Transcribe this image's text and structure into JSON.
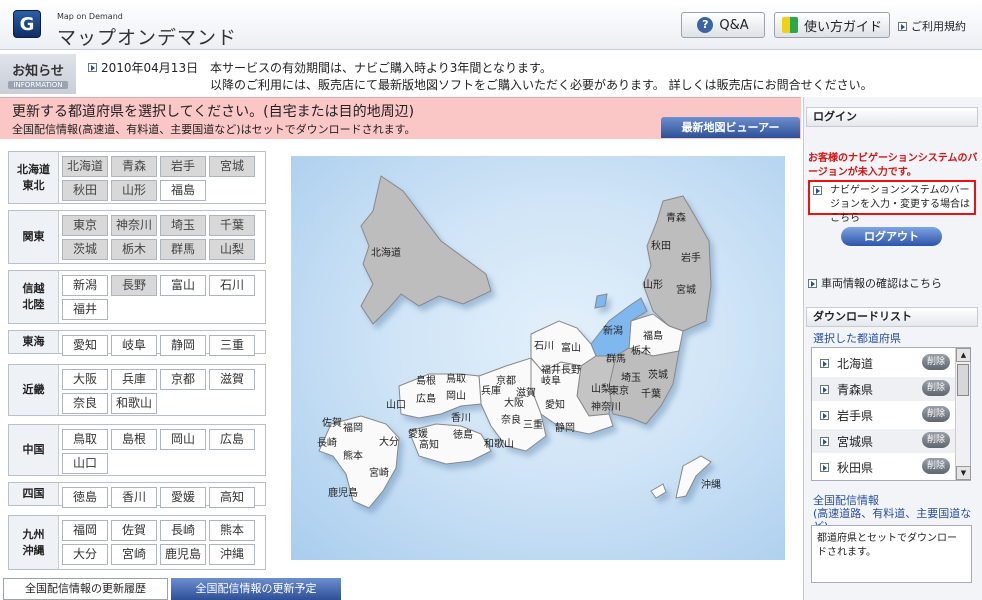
{
  "header": {
    "logo_letter": "G",
    "logo_sub": "Map on Demand",
    "title": "マップオンデマンド",
    "qa_label": "Q&A",
    "qa_icon": "?",
    "guide_label": "使い方ガイド",
    "terms_label": "ご利用規約"
  },
  "info": {
    "tag": "お知らせ",
    "tag_sub": "INFORMATION",
    "date": "2010年04月13日",
    "line1": "本サービスの有効期間は、ナビご購入時より3年間となります。",
    "line2": "以降のご利用には、販売店にて最新版地図ソフトをご購入いただく必要があります。 詳しくは販売店にお問合せください。"
  },
  "select": {
    "title": "更新する都道府県を選択してください。(自宅または目的地周辺)",
    "subtitle": "全国配信情報(高速道、有料道、主要国道など)はセットでダウンロードされます。",
    "viewer_button": "最新地図ビューアー"
  },
  "regions": [
    {
      "label": [
        "北海道",
        "東北"
      ],
      "prefs": [
        {
          "name": "北海道",
          "selected": true
        },
        {
          "name": "青森",
          "selected": true
        },
        {
          "name": "岩手",
          "selected": true
        },
        {
          "name": "宮城",
          "selected": true
        },
        {
          "name": "秋田",
          "selected": true
        },
        {
          "name": "山形",
          "selected": true
        },
        {
          "name": "福島",
          "selected": false
        }
      ]
    },
    {
      "label": [
        "関東"
      ],
      "prefs": [
        {
          "name": "東京",
          "selected": true
        },
        {
          "name": "神奈川",
          "selected": true
        },
        {
          "name": "埼玉",
          "selected": true
        },
        {
          "name": "千葉",
          "selected": true
        },
        {
          "name": "茨城",
          "selected": true
        },
        {
          "name": "栃木",
          "selected": true
        },
        {
          "name": "群馬",
          "selected": true
        },
        {
          "name": "山梨",
          "selected": true
        }
      ]
    },
    {
      "label": [
        "信越",
        "北陸"
      ],
      "prefs": [
        {
          "name": "新潟",
          "selected": false
        },
        {
          "name": "長野",
          "selected": true
        },
        {
          "name": "富山",
          "selected": false
        },
        {
          "name": "石川",
          "selected": false
        },
        {
          "name": "福井",
          "selected": false
        }
      ]
    },
    {
      "label": [
        "東海"
      ],
      "prefs": [
        {
          "name": "愛知",
          "selected": false
        },
        {
          "name": "岐阜",
          "selected": false
        },
        {
          "name": "静岡",
          "selected": false
        },
        {
          "name": "三重",
          "selected": false
        }
      ]
    },
    {
      "label": [
        "近畿"
      ],
      "prefs": [
        {
          "name": "大阪",
          "selected": false
        },
        {
          "name": "兵庫",
          "selected": false
        },
        {
          "name": "京都",
          "selected": false
        },
        {
          "name": "滋賀",
          "selected": false
        },
        {
          "name": "奈良",
          "selected": false
        },
        {
          "name": "和歌山",
          "selected": false
        }
      ]
    },
    {
      "label": [
        "中国"
      ],
      "prefs": [
        {
          "name": "鳥取",
          "selected": false
        },
        {
          "name": "島根",
          "selected": false
        },
        {
          "name": "岡山",
          "selected": false
        },
        {
          "name": "広島",
          "selected": false
        },
        {
          "name": "山口",
          "selected": false
        }
      ]
    },
    {
      "label": [
        "四国"
      ],
      "prefs": [
        {
          "name": "徳島",
          "selected": false
        },
        {
          "name": "香川",
          "selected": false
        },
        {
          "name": "愛媛",
          "selected": false
        },
        {
          "name": "高知",
          "selected": false
        }
      ]
    },
    {
      "label": [
        "九州",
        "沖縄"
      ],
      "prefs": [
        {
          "name": "福岡",
          "selected": false
        },
        {
          "name": "佐賀",
          "selected": false
        },
        {
          "name": "長崎",
          "selected": false
        },
        {
          "name": "熊本",
          "selected": false
        },
        {
          "name": "大分",
          "selected": false
        },
        {
          "name": "宮崎",
          "selected": false
        },
        {
          "name": "鹿児島",
          "selected": false
        },
        {
          "name": "沖縄",
          "selected": false
        }
      ]
    }
  ],
  "map_labels": [
    "北海道",
    "青森",
    "秋田",
    "岩手",
    "山形",
    "宮城",
    "新潟",
    "福島",
    "石川",
    "富山",
    "群馬",
    "栃木",
    "茨城",
    "長野",
    "埼玉",
    "東京",
    "千葉",
    "山梨",
    "神奈川",
    "静岡",
    "福井",
    "岐阜",
    "愛知",
    "滋賀",
    "三重",
    "京都",
    "大阪",
    "奈良",
    "和歌山",
    "兵庫",
    "鳥取",
    "島根",
    "岡山",
    "広島",
    "山口",
    "香川",
    "徳島",
    "愛媛",
    "高知",
    "福岡",
    "佐賀",
    "長崎",
    "大分",
    "熊本",
    "宮崎",
    "鹿児島",
    "沖縄"
  ],
  "tabs": {
    "history": "全国配信情報の更新履歴",
    "schedule": "全国配信情報の更新予定"
  },
  "sidebar": {
    "login_header": "ログイン",
    "login_msg": "お客様のナビゲーションシステムのバージョンが未入力です。",
    "nav_version_link": "ナビゲーションシステムのバージョンを入力・変更する場合はこちら",
    "logout": "ログアウト",
    "vehicle_link": "車両情報の確認はこちら",
    "download_header": "ダウンロードリスト",
    "selected_label": "選択した都道府県",
    "downloads": [
      "北海道",
      "青森県",
      "岩手県",
      "宮城県",
      "秋田県"
    ],
    "delete_label": "削除",
    "bulk_title": "全国配信情報",
    "bulk_sub": "(高速道路、有料道、主要国道など)",
    "bulk_text": "都道府県とセットでダウンロードされます。"
  },
  "colors": {
    "selected": "#d8d8d8",
    "accent_red": "#d41414",
    "link_blue": "#2850a0",
    "map_sea": "#cfe4f6",
    "map_selected": "#bdbdbd",
    "map_nagano": "#c4c4c4",
    "map_niigata": "#7eb8ef"
  }
}
